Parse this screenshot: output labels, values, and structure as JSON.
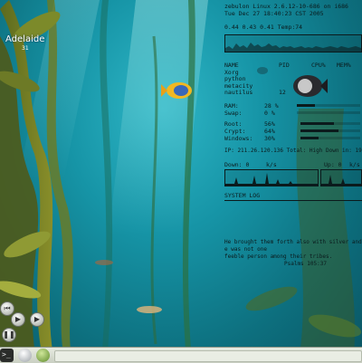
{
  "weather": {
    "city": "Adelaide",
    "temp": "31"
  },
  "monitor": {
    "system": "zebulon Linux 2.6.12-10-686 on i686",
    "datetime": "Tue Dec 27 18:40:23 CST 2005",
    "load": "0.44 0.43 0.41 Temp:74",
    "proc_headers": [
      "NAME",
      "PID",
      "CPU%",
      "MEM%"
    ],
    "processes": [
      [
        "Xorg",
        "",
        "",
        ""
      ],
      [
        "python",
        "",
        "",
        ""
      ],
      [
        "metacity",
        "",
        "",
        ""
      ],
      [
        "nautilus",
        "12",
        "",
        ""
      ]
    ],
    "memory": [
      {
        "label": "RAM:",
        "value": "28 %",
        "fraction": 0.28
      },
      {
        "label": "Swap:",
        "value": "0 %",
        "fraction": 0.0
      }
    ],
    "disks": [
      {
        "label": "Root:",
        "value": "56%",
        "fraction": 0.56
      },
      {
        "label": "Crypt:",
        "value": "64%",
        "fraction": 0.64
      },
      {
        "label": "Windows:",
        "value": "30%",
        "fraction": 0.3
      }
    ],
    "ip_line": "IP: 211.26.120.136 Total: High Down in: 190k",
    "net": {
      "down_label": "Down: 0",
      "down_unit": "k/s",
      "up_label": "Up: 0",
      "up_unit": "k/s"
    },
    "syslog_title": "SYSTEM LOG",
    "quote": [
      "He brought them forth also with silver and",
      "e was not one",
      "feeble person among their tribes.",
      "Psalms 105:37"
    ]
  },
  "colors": {
    "text": "#0b1a1c",
    "water": "#1694a6",
    "taskbar": "#d8ddd2"
  },
  "icons": [
    "terminal-icon",
    "browser-icon",
    "apple-icon",
    "previous-icon",
    "play-icon",
    "pause-icon",
    "record-icon"
  ]
}
